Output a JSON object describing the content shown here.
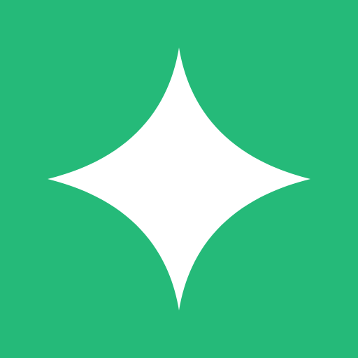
{
  "icon": {
    "name": "sparkle-icon",
    "background_color": "#25BA79",
    "glyph_color": "#FFFFFF"
  }
}
